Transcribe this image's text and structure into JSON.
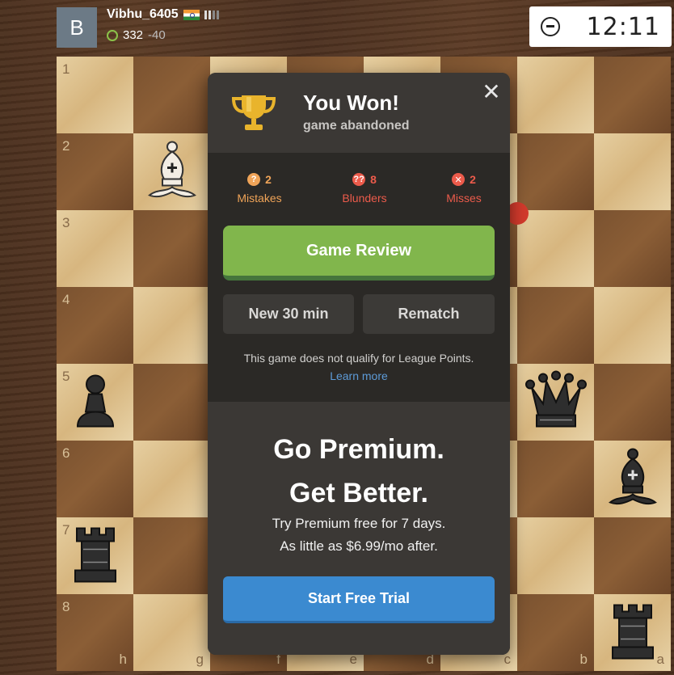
{
  "player": {
    "avatar_letter": "B",
    "name": "Vibhu_6405",
    "rating": "332",
    "rating_change": "-40"
  },
  "clock": {
    "time": "12:11"
  },
  "board": {
    "ranks": [
      "1",
      "2",
      "3",
      "4",
      "5",
      "6",
      "7",
      "8"
    ],
    "files": [
      "h",
      "g",
      "f",
      "e",
      "d",
      "c",
      "b",
      "a"
    ]
  },
  "modal": {
    "title": "You Won!",
    "subtitle": "game abandoned",
    "close_label": "✕",
    "stats": {
      "mistakes": {
        "count": "2",
        "label": "Mistakes",
        "color": "#f0a458"
      },
      "blunders": {
        "count": "8",
        "label": "Blunders",
        "color": "#ec5b4b"
      },
      "misses": {
        "count": "2",
        "label": "Misses",
        "color": "#ec5b4b"
      }
    },
    "game_review_label": "Game Review",
    "new_game_label": "New 30 min",
    "rematch_label": "Rematch",
    "league_note": "This game does not qualify for League Points.",
    "learn_more_label": "Learn more",
    "premium": {
      "title_line1": "Go Premium.",
      "title_line2": "Get Better.",
      "sub_line1": "Try Premium free for 7 days.",
      "sub_line2": "As little as $6.99/mo after.",
      "trial_label": "Start Free Trial"
    }
  },
  "colors": {
    "accent_green": "#81b64c",
    "accent_blue": "#3b8ad0",
    "modal_bg": "#2b2926"
  }
}
